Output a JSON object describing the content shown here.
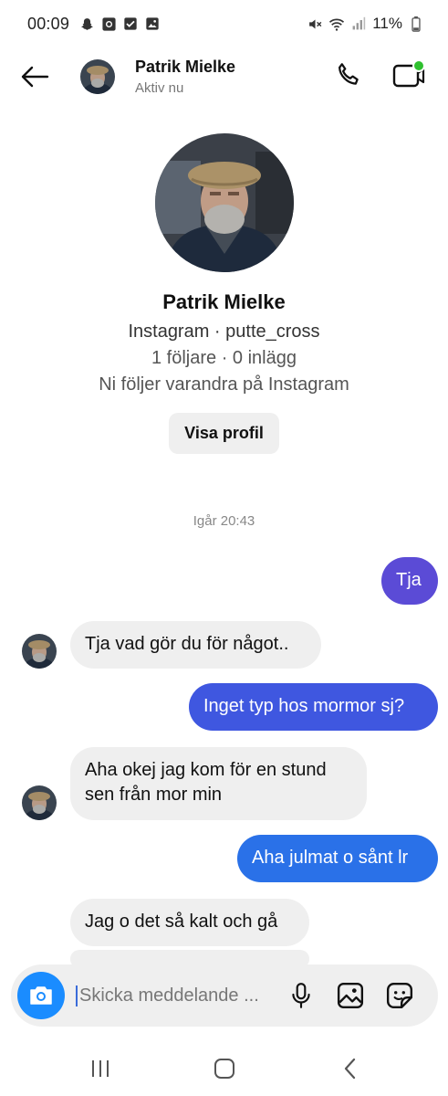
{
  "status_bar": {
    "time": "00:09",
    "battery": "11%",
    "left_icons": [
      "snapchat-icon",
      "camera-icon",
      "check-icon",
      "gallery-icon"
    ],
    "right_icons": [
      "mute-icon",
      "wifi-icon",
      "signal-icon",
      "battery-icon"
    ]
  },
  "header": {
    "name": "Patrik Mielke",
    "status": "Aktiv nu",
    "online_color": "#2fc02f"
  },
  "profile": {
    "name": "Patrik Mielke",
    "platform_line": "Instagram · putte_cross",
    "stats_line": "1 följare · 0 inlägg",
    "mutual_line": "Ni följer varandra på Instagram",
    "button_label": "Visa profil"
  },
  "conversation": {
    "timestamp": "Igår 20:43",
    "messages": [
      {
        "direction": "outgoing",
        "text": "Tja",
        "color": "#5b4bd6"
      },
      {
        "direction": "incoming",
        "text": "Tja vad gör du för något.."
      },
      {
        "direction": "outgoing",
        "text": "Inget typ hos mormor sj?",
        "color": "#3f57e0"
      },
      {
        "direction": "incoming",
        "text": "Aha okej jag kom för en stund sen från mor min"
      },
      {
        "direction": "outgoing",
        "text": "Aha julmat o sånt lr",
        "color": "#2a71e8"
      },
      {
        "direction": "incoming",
        "text": "Jag o det så kalt och gå"
      }
    ]
  },
  "composer": {
    "placeholder": "Skicka meddelande ...",
    "camera_color": "#1a8cff"
  },
  "colors": {
    "incoming_bubble": "#efefef",
    "accent": "#3f57e0"
  }
}
